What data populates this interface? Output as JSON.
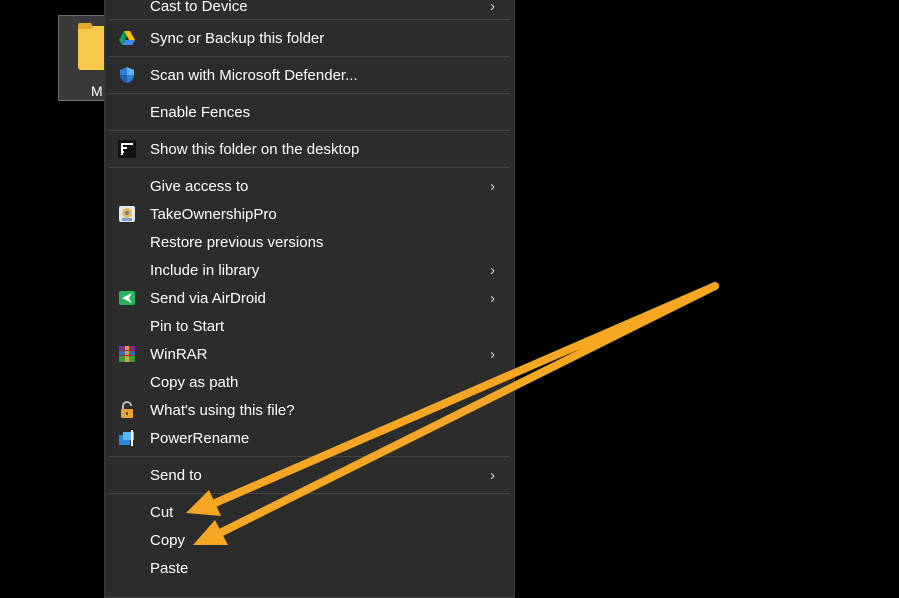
{
  "desktop_icon": {
    "label": "M"
  },
  "menu": {
    "items": [
      {
        "label": "Cast to Device",
        "icon": "none",
        "submenu": true
      },
      {
        "label": "Sync or Backup this folder",
        "icon": "google-drive-icon",
        "submenu": false
      },
      {
        "label": "Scan with Microsoft Defender...",
        "icon": "defender-shield-icon",
        "submenu": false
      },
      {
        "label": "Enable Fences",
        "icon": "none",
        "submenu": false
      },
      {
        "label": "Show this folder on the desktop",
        "icon": "fences-icon",
        "submenu": false
      },
      {
        "label": "Give access to",
        "icon": "none",
        "submenu": true
      },
      {
        "label": "TakeOwnershipPro",
        "icon": "takeownership-icon",
        "submenu": false
      },
      {
        "label": "Restore previous versions",
        "icon": "none",
        "submenu": false
      },
      {
        "label": "Include in library",
        "icon": "none",
        "submenu": true
      },
      {
        "label": "Send via AirDroid",
        "icon": "airdroid-icon",
        "submenu": true
      },
      {
        "label": "Pin to Start",
        "icon": "none",
        "submenu": false
      },
      {
        "label": "WinRAR",
        "icon": "winrar-icon",
        "submenu": true
      },
      {
        "label": "Copy as path",
        "icon": "none",
        "submenu": false
      },
      {
        "label": "What's using this file?",
        "icon": "lock-icon",
        "submenu": false
      },
      {
        "label": "PowerRename",
        "icon": "powerrename-icon",
        "submenu": false
      },
      {
        "label": "Send to",
        "icon": "none",
        "submenu": true
      },
      {
        "label": "Cut",
        "icon": "none",
        "submenu": false
      },
      {
        "label": "Copy",
        "icon": "none",
        "submenu": false
      },
      {
        "label": "Paste",
        "icon": "none",
        "submenu": false
      }
    ],
    "chevron_glyph": "›"
  },
  "colors": {
    "menu_bg": "#2c2c2c",
    "separator": "#454545",
    "arrow": "#f5a623"
  }
}
